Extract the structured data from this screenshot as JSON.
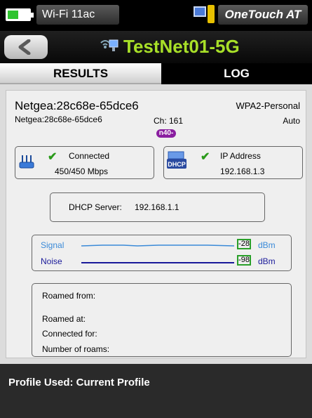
{
  "status_bar": {
    "wifi_label": "Wi-Fi 11ac",
    "device_name": "OneTouch AT",
    "battery_icon": "battery-icon",
    "tray_icon": "network-device-icon"
  },
  "title_bar": {
    "back_icon": "back-arrow-icon",
    "network_icon": "wifi-network-icon",
    "title": "TestNet01-5G"
  },
  "tabs": {
    "results": "RESULTS",
    "log": "LOG",
    "active": "RESULTS"
  },
  "network": {
    "ssid": "Netgea:28c68e-65dce6",
    "ssid_small": "Netgea:28c68e-65dce6",
    "security": "WPA2-Personal",
    "channel": "Ch: 161",
    "mode": "Auto",
    "width_badge": "n40-"
  },
  "connection": {
    "label": "Connected",
    "rate": "450/450 Mbps"
  },
  "ip": {
    "label": "IP Address",
    "address": "192.168.1.3",
    "icon_text": "DHCP"
  },
  "dhcp": {
    "label": "DHCP Server:",
    "address": "192.168.1.1"
  },
  "signal": {
    "signal_label": "Signal",
    "signal_value": "-28",
    "signal_unit": "dBm",
    "noise_label": "Noise",
    "noise_value": "-98",
    "noise_unit": "dBm",
    "signal_color": "#3a8ad8",
    "noise_color": "#1a1a9a"
  },
  "roaming": {
    "roamed_from": "Roamed from:",
    "roamed_at": "Roamed at:",
    "connected_for": "Connected for:",
    "number_of_roams": "Number of roams:"
  },
  "footer": {
    "profile": "Profile Used: Current Profile"
  },
  "colors": {
    "title": "#a8e028",
    "check": "#2a9a1a",
    "badge": "#8a1ea0",
    "value_border": "#2aa02a"
  }
}
